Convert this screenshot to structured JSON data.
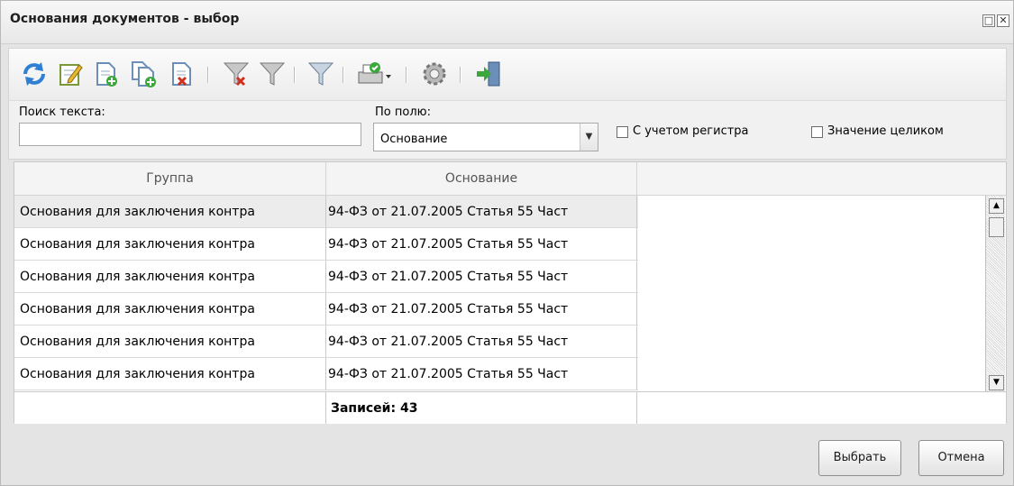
{
  "window": {
    "title": "Основания документов - выбор"
  },
  "toolbar": {
    "icons": [
      "refresh-icon",
      "edit-icon",
      "add-icon",
      "add-copy-icon",
      "delete-icon",
      "clear-filter-icon",
      "filter-icon",
      "filter-panel-icon",
      "print-icon",
      "settings-icon",
      "exit-icon"
    ]
  },
  "search": {
    "label": "Поиск текста:",
    "value": "",
    "field_label": "По полю:",
    "field_value": "Основание",
    "case_label": "С учетом регистра",
    "whole_label": "Значение целиком"
  },
  "grid": {
    "columns": [
      "Группа",
      "Основание"
    ],
    "rows": [
      [
        "Основания для заключения контра",
        "94-ФЗ от 21.07.2005 Статья 55 Част"
      ],
      [
        "Основания для заключения контра",
        "94-ФЗ от 21.07.2005 Статья 55 Част"
      ],
      [
        "Основания для заключения контра",
        "94-ФЗ от 21.07.2005 Статья 55 Част"
      ],
      [
        "Основания для заключения контра",
        "94-ФЗ от 21.07.2005 Статья 55 Част"
      ],
      [
        "Основания для заключения контра",
        "94-ФЗ от 21.07.2005 Статья 55 Част"
      ],
      [
        "Основания для заключения контра",
        "94-ФЗ от 21.07.2005 Статья 55 Част"
      ]
    ],
    "records": "Записей: 43"
  },
  "buttons": {
    "select": "Выбрать",
    "cancel": "Отмена"
  },
  "colors": {
    "accent": "#2f7fd3",
    "window_bg": "#e4e4e4",
    "selected_row": "#ececec"
  }
}
